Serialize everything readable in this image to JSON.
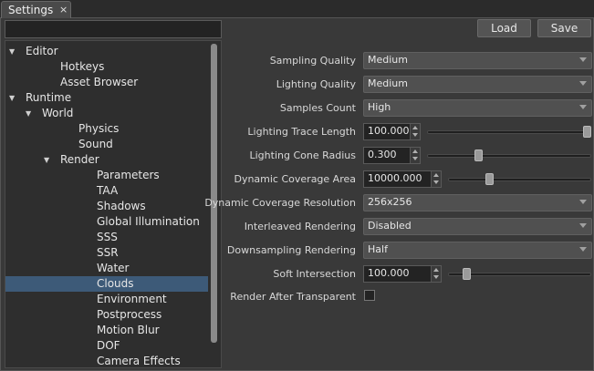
{
  "tab": {
    "label": "Settings",
    "close": "×"
  },
  "toolbar": {
    "load_label": "Load",
    "save_label": "Save"
  },
  "search": {
    "value": "",
    "placeholder": ""
  },
  "tree": {
    "items": [
      {
        "label": "Editor",
        "depth": 0,
        "expandable": true,
        "selected": false
      },
      {
        "label": "Hotkeys",
        "depth": 1,
        "expandable": false,
        "selected": false
      },
      {
        "label": "Asset Browser",
        "depth": 1,
        "expandable": false,
        "selected": false
      },
      {
        "label": "Runtime",
        "depth": 0,
        "expandable": true,
        "selected": false
      },
      {
        "label": "World",
        "depth": 1,
        "expandable": true,
        "selected": false
      },
      {
        "label": "Physics",
        "depth": 2,
        "expandable": false,
        "selected": false
      },
      {
        "label": "Sound",
        "depth": 2,
        "expandable": false,
        "selected": false
      },
      {
        "label": "Render",
        "depth": 2,
        "expandable": true,
        "selected": false
      },
      {
        "label": "Parameters",
        "depth": 3,
        "expandable": false,
        "selected": false
      },
      {
        "label": "TAA",
        "depth": 3,
        "expandable": false,
        "selected": false
      },
      {
        "label": "Shadows",
        "depth": 3,
        "expandable": false,
        "selected": false
      },
      {
        "label": "Global Illumination",
        "depth": 3,
        "expandable": false,
        "selected": false
      },
      {
        "label": "SSS",
        "depth": 3,
        "expandable": false,
        "selected": false
      },
      {
        "label": "SSR",
        "depth": 3,
        "expandable": false,
        "selected": false
      },
      {
        "label": "Water",
        "depth": 3,
        "expandable": false,
        "selected": false
      },
      {
        "label": "Clouds",
        "depth": 3,
        "expandable": false,
        "selected": true
      },
      {
        "label": "Environment",
        "depth": 3,
        "expandable": false,
        "selected": false
      },
      {
        "label": "Postprocess",
        "depth": 3,
        "expandable": false,
        "selected": false
      },
      {
        "label": "Motion Blur",
        "depth": 3,
        "expandable": false,
        "selected": false
      },
      {
        "label": "DOF",
        "depth": 3,
        "expandable": false,
        "selected": false
      },
      {
        "label": "Camera Effects",
        "depth": 3,
        "expandable": false,
        "selected": false
      }
    ]
  },
  "props": {
    "sampling_quality": {
      "label": "Sampling Quality",
      "value": "Medium"
    },
    "lighting_quality": {
      "label": "Lighting Quality",
      "value": "Medium"
    },
    "samples_count": {
      "label": "Samples Count",
      "value": "High"
    },
    "lighting_trace_length": {
      "label": "Lighting Trace Length",
      "value": "100.000",
      "slider_fraction": 1.0
    },
    "lighting_cone_radius": {
      "label": "Lighting Cone Radius",
      "value": "0.300",
      "slider_fraction": 0.3
    },
    "dynamic_coverage_area": {
      "label": "Dynamic Coverage Area",
      "value": "10000.000",
      "slider_fraction": 0.27
    },
    "dynamic_coverage_resolution": {
      "label": "Dynamic Coverage Resolution",
      "value": "256x256"
    },
    "interleaved_rendering": {
      "label": "Interleaved Rendering",
      "value": "Disabled"
    },
    "downsampling_rendering": {
      "label": "Downsampling Rendering",
      "value": "Half"
    },
    "soft_intersection": {
      "label": "Soft Intersection",
      "value": "100.000",
      "slider_fraction": 0.1
    },
    "render_after_transparent": {
      "label": "Render After Transparent",
      "checked": false
    }
  },
  "colors": {
    "selection": "#3d5a78",
    "panel": "#393939",
    "tree_bg": "#2e2e2e"
  }
}
